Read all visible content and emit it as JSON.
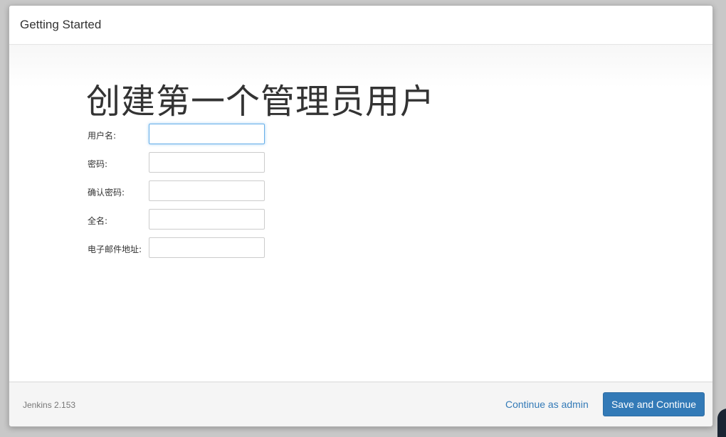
{
  "dialog": {
    "title": "Getting Started"
  },
  "main": {
    "heading": "创建第一个管理员用户",
    "fields": [
      {
        "label": "用户名:",
        "value": ""
      },
      {
        "label": "密码:",
        "value": ""
      },
      {
        "label": "确认密码:",
        "value": ""
      },
      {
        "label": "全名:",
        "value": ""
      },
      {
        "label": "电子邮件地址:",
        "value": ""
      }
    ]
  },
  "footer": {
    "version": "Jenkins 2.153",
    "continue_admin_label": "Continue as admin",
    "save_continue_label": "Save and Continue"
  },
  "colors": {
    "accent": "#337ab7",
    "focus_border": "#66afe9"
  }
}
